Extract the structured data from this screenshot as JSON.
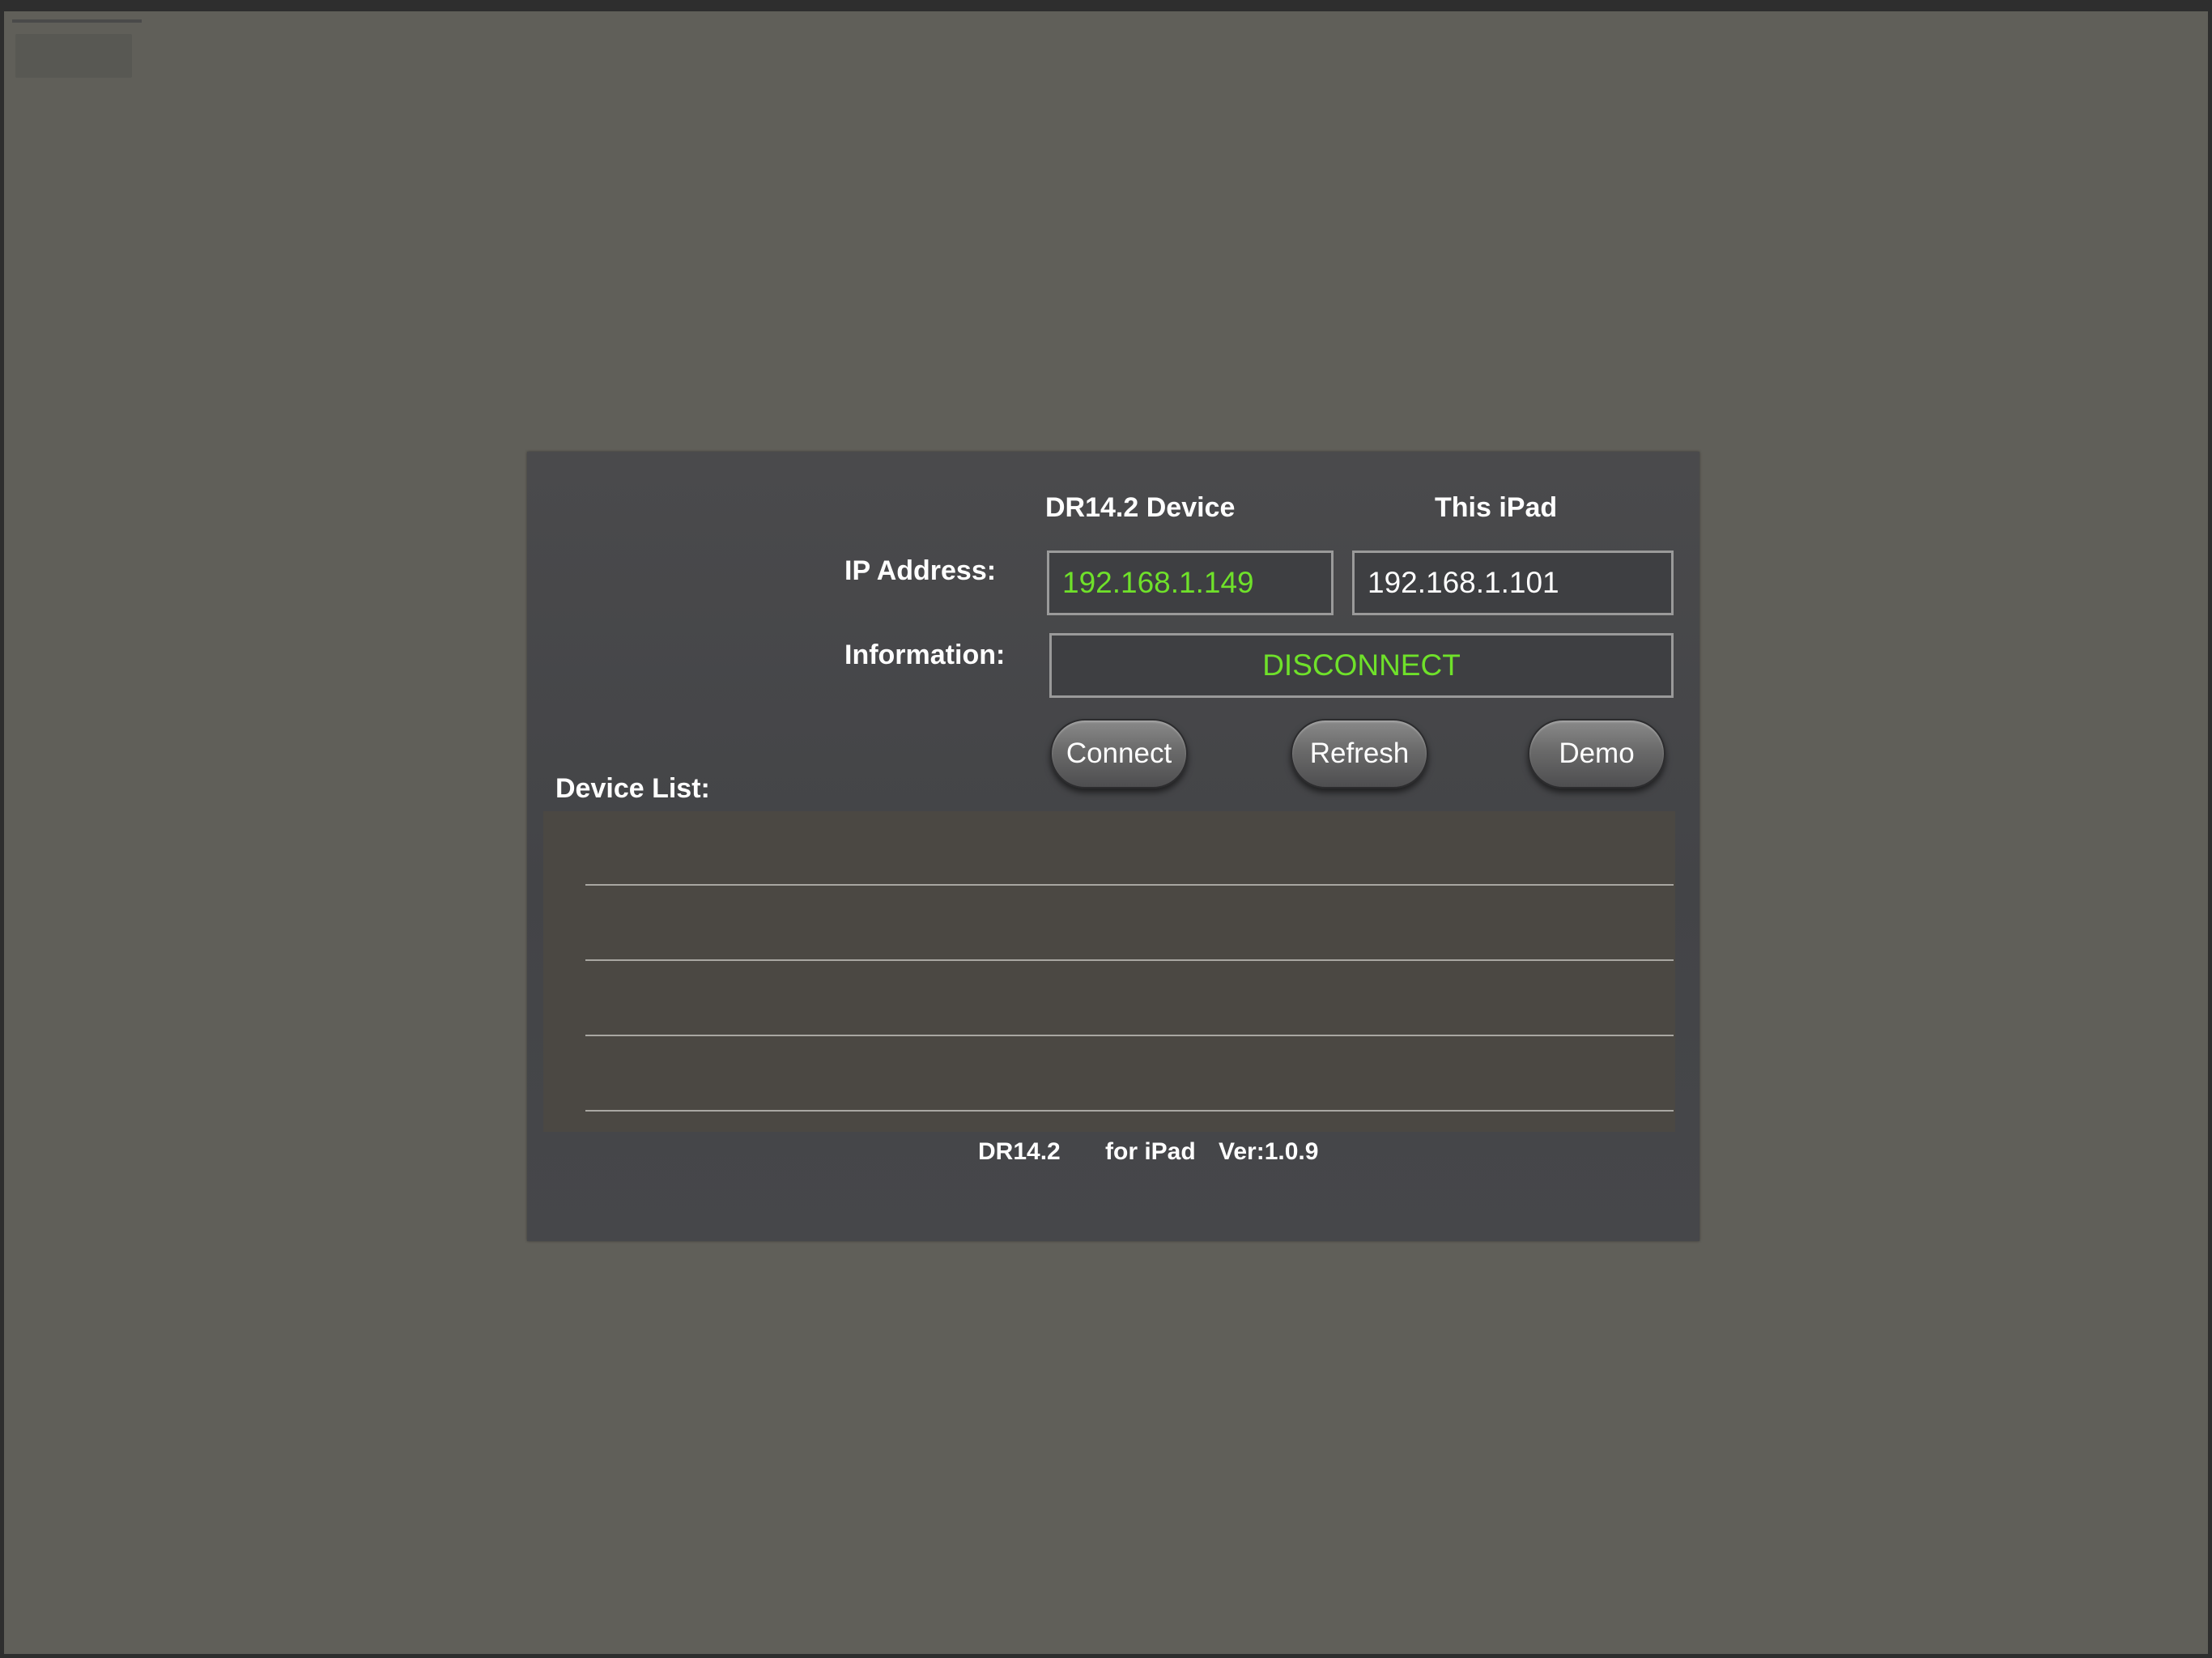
{
  "header": {
    "device_column": "DR14.2 Device",
    "ipad_column": "This iPad"
  },
  "ip_address": {
    "label": "IP Address:",
    "device_value": "192.168.1.149",
    "ipad_value": "192.168.1.101"
  },
  "information": {
    "label": "Information:",
    "value": "DISCONNECT"
  },
  "buttons": {
    "connect": "Connect",
    "refresh": "Refresh",
    "demo": "Demo"
  },
  "device_list": {
    "label": "Device List:",
    "items": []
  },
  "footer": {
    "model": "DR14.2",
    "platform": "for iPad",
    "version": "Ver:1.0.9"
  },
  "colors": {
    "status_green": "#6fe12a",
    "background": "#605f59",
    "panel": "#46474a"
  }
}
